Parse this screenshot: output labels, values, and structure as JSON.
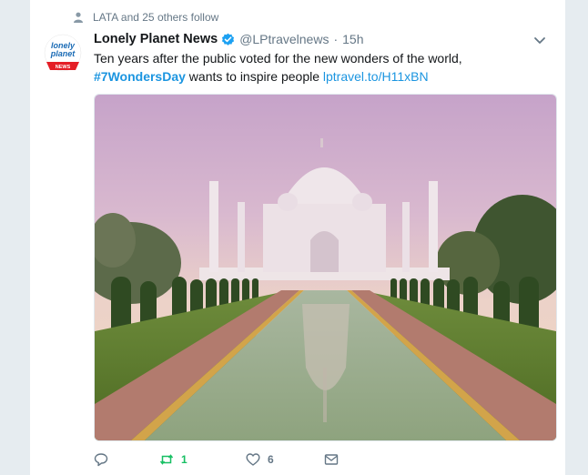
{
  "social_context": {
    "text": "LATA and 25 others follow"
  },
  "tweet": {
    "author_name": "Lonely Planet News",
    "handle": "@LPtravelnews",
    "separator": "·",
    "time": "15h",
    "text_line1": "Ten years after the public voted for the new wonders of the world,",
    "hashtag": "#7WondersDay",
    "text_rest": " wants to inspire people ",
    "link": "lptravel.to/H11xBN",
    "avatar_logo_line1": "lonely",
    "avatar_logo_line2": "planet",
    "avatar_badge": "NEWS"
  },
  "actions": {
    "reply_count": "",
    "retweet_count": "1",
    "like_count": "6"
  },
  "colors": {
    "accent": "#1b95e0",
    "retweet": "#17bf63",
    "muted": "#657786",
    "logo_red": "#e41e26"
  },
  "icons": [
    "person-icon",
    "verified-badge-icon",
    "chevron-down-icon",
    "reply-icon",
    "retweet-icon",
    "heart-icon",
    "envelope-icon"
  ]
}
